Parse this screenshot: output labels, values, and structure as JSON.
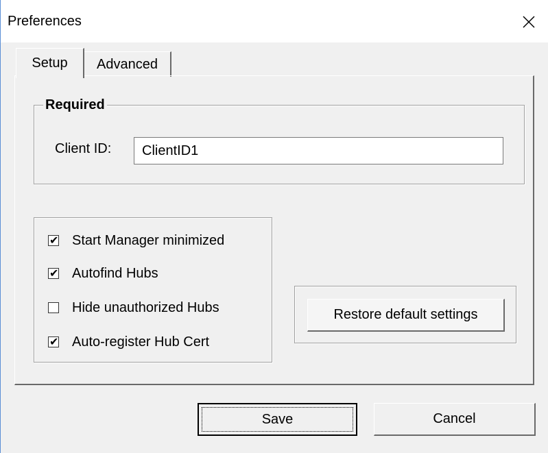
{
  "window": {
    "title": "Preferences",
    "close_icon": "close-icon"
  },
  "tabs": [
    {
      "label": "Setup",
      "active": true
    },
    {
      "label": "Advanced",
      "active": false
    }
  ],
  "required_group": {
    "legend": "Required",
    "client_id_label": "Client ID:",
    "client_id_value": "ClientID1"
  },
  "options": [
    {
      "label": "Start Manager minimized",
      "checked": true
    },
    {
      "label": "Autofind Hubs",
      "checked": true
    },
    {
      "label": "Hide unauthorized Hubs",
      "checked": false
    },
    {
      "label": "Auto-register Hub Cert",
      "checked": true
    }
  ],
  "buttons": {
    "restore_label": "Restore default settings",
    "save_label": "Save",
    "cancel_label": "Cancel"
  },
  "colors": {
    "window_bg": "#f0f0f0",
    "titlebar_bg": "#ffffff",
    "window_border": "#5b8fd6"
  }
}
